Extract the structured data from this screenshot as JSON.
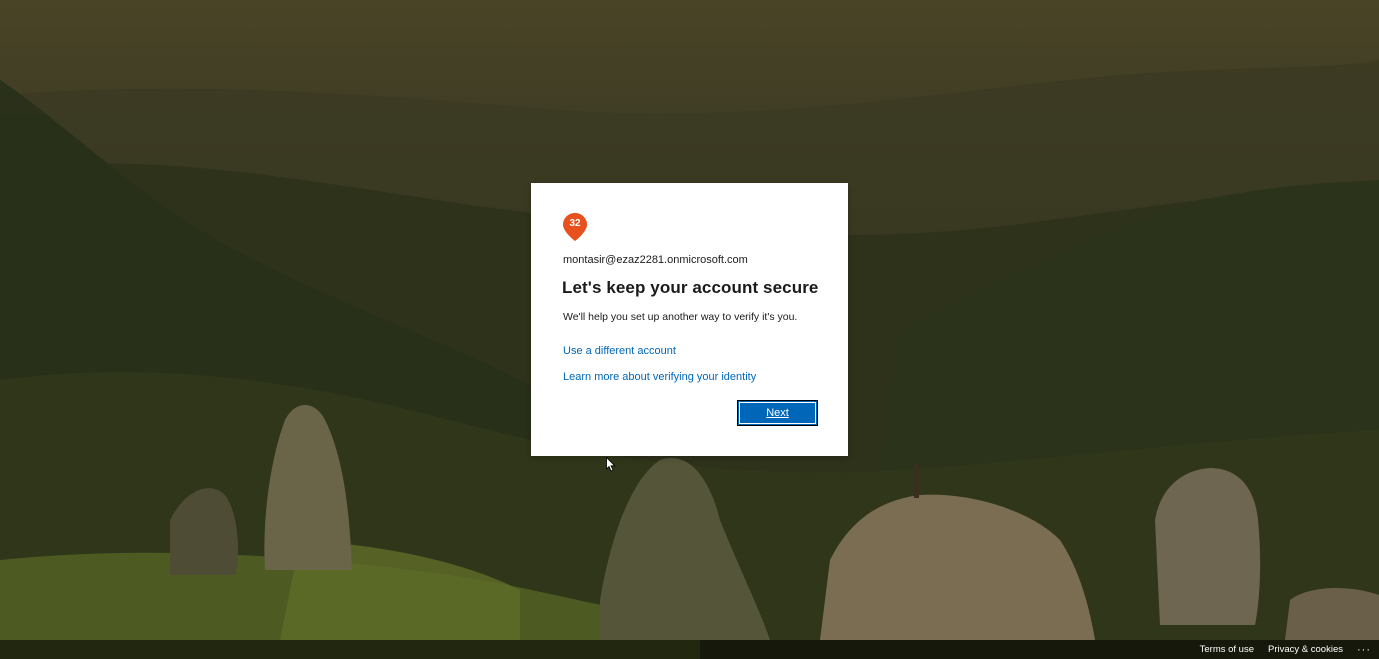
{
  "background": {
    "description_icon": "mountain-landscape-background"
  },
  "card": {
    "logo_badge": "32",
    "logo_icon": "map-pin-logo-icon",
    "logo_color": "#e8501d",
    "account_email": "montasir@ezaz2281.onmicrosoft.com",
    "title": "Let's keep your account secure",
    "subtitle": "We'll help you set up another way to verify it's you.",
    "links": {
      "different_account": "Use a different account",
      "learn_more": "Learn more about verifying your identity"
    },
    "next_label": "Next",
    "accent_color": "#0067b8"
  },
  "footer": {
    "terms": "Terms of use",
    "privacy": "Privacy & cookies",
    "more": "···"
  }
}
